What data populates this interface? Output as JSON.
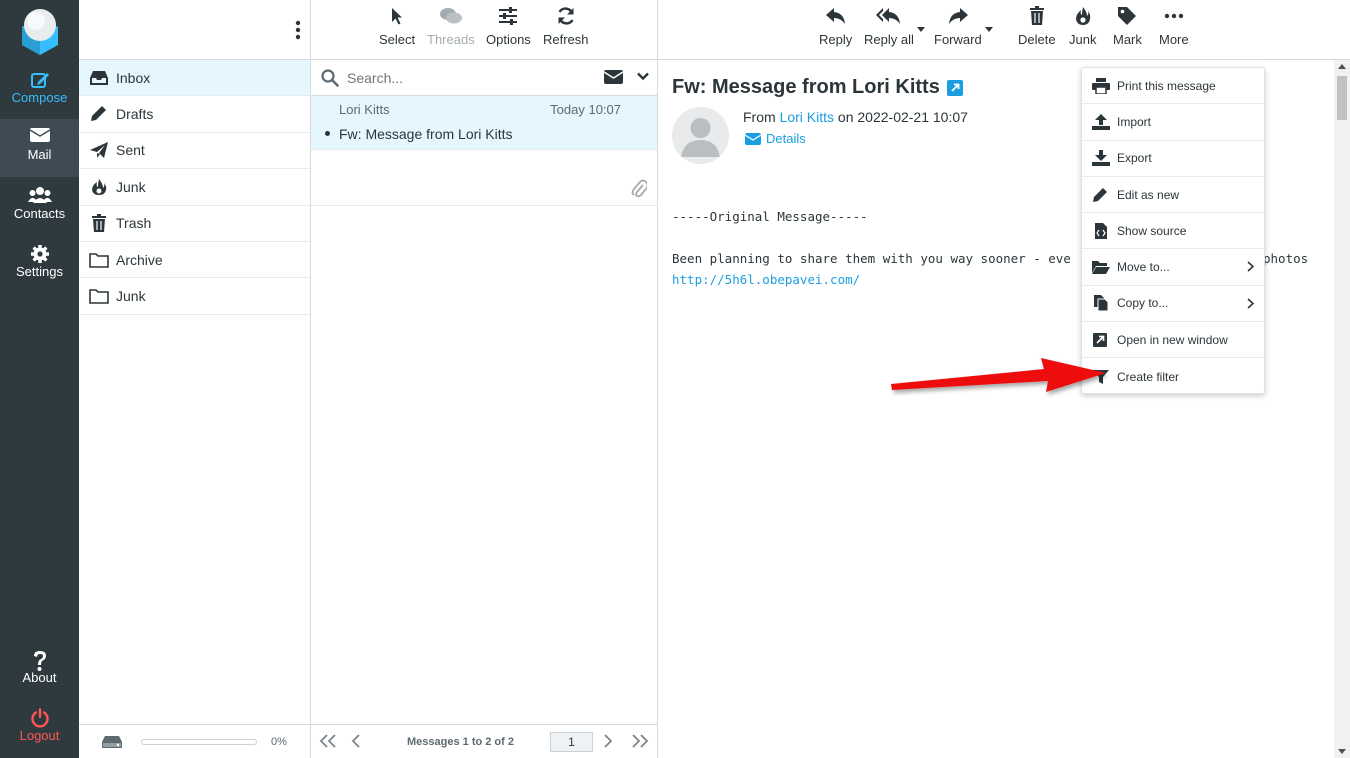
{
  "nav": {
    "compose": "Compose",
    "mail": "Mail",
    "contacts": "Contacts",
    "settings": "Settings",
    "about": "About",
    "logout": "Logout"
  },
  "folders": [
    {
      "label": "Inbox",
      "icon": "inbox-icon"
    },
    {
      "label": "Drafts",
      "icon": "pencil-icon"
    },
    {
      "label": "Sent",
      "icon": "paper-plane-icon"
    },
    {
      "label": "Junk",
      "icon": "fire-icon"
    },
    {
      "label": "Trash",
      "icon": "trash-icon"
    },
    {
      "label": "Archive",
      "icon": "folder-icon"
    },
    {
      "label": "Junk",
      "icon": "folder-icon"
    }
  ],
  "quota": {
    "percent_label": "0%",
    "fraction": 0
  },
  "list_toolbar": {
    "select": "Select",
    "threads": "Threads",
    "options": "Options",
    "refresh": "Refresh"
  },
  "search": {
    "placeholder": "Search..."
  },
  "messages": [
    {
      "from": "Lori Kitts",
      "date": "Today 10:07",
      "subject": "Fw: Message from Lori Kitts"
    }
  ],
  "pagination": {
    "text": "Messages 1 to 2 of 2",
    "page": "1"
  },
  "view_toolbar": {
    "reply": "Reply",
    "reply_all": "Reply all",
    "forward": "Forward",
    "delete": "Delete",
    "junk": "Junk",
    "mark": "Mark",
    "more": "More"
  },
  "message": {
    "subject": "Fw: Message from Lori Kitts",
    "from_prefix": "From",
    "from_name": "Lori Kitts",
    "date_text": "on 2022-02-21 10:07",
    "details": "Details",
    "body_header": "-----Original Message-----",
    "body_line": "Been planning to share them with you way sooner - eve",
    "body_line_tail": "photos",
    "body_link": "http://5h6l.obepavei.com/"
  },
  "more_menu": [
    {
      "label": "Print this message",
      "icon": "printer-icon"
    },
    {
      "label": "Import",
      "icon": "upload-icon"
    },
    {
      "label": "Export",
      "icon": "download-icon"
    },
    {
      "label": "Edit as new",
      "icon": "pencil-icon"
    },
    {
      "label": "Show source",
      "icon": "file-code-icon"
    },
    {
      "label": "Move to...",
      "icon": "folder-open-icon"
    },
    {
      "label": "Copy to...",
      "icon": "copy-icon"
    },
    {
      "label": "Open in new window",
      "icon": "external-link-icon"
    },
    {
      "label": "Create filter",
      "icon": "filter-icon"
    }
  ],
  "colors": {
    "sidebar": "#2f3a3f",
    "accent": "#37beff",
    "link": "#1a9ee0",
    "logout": "#ff5552",
    "selection": "#e5f6ff",
    "arrow": "#ee1111"
  }
}
